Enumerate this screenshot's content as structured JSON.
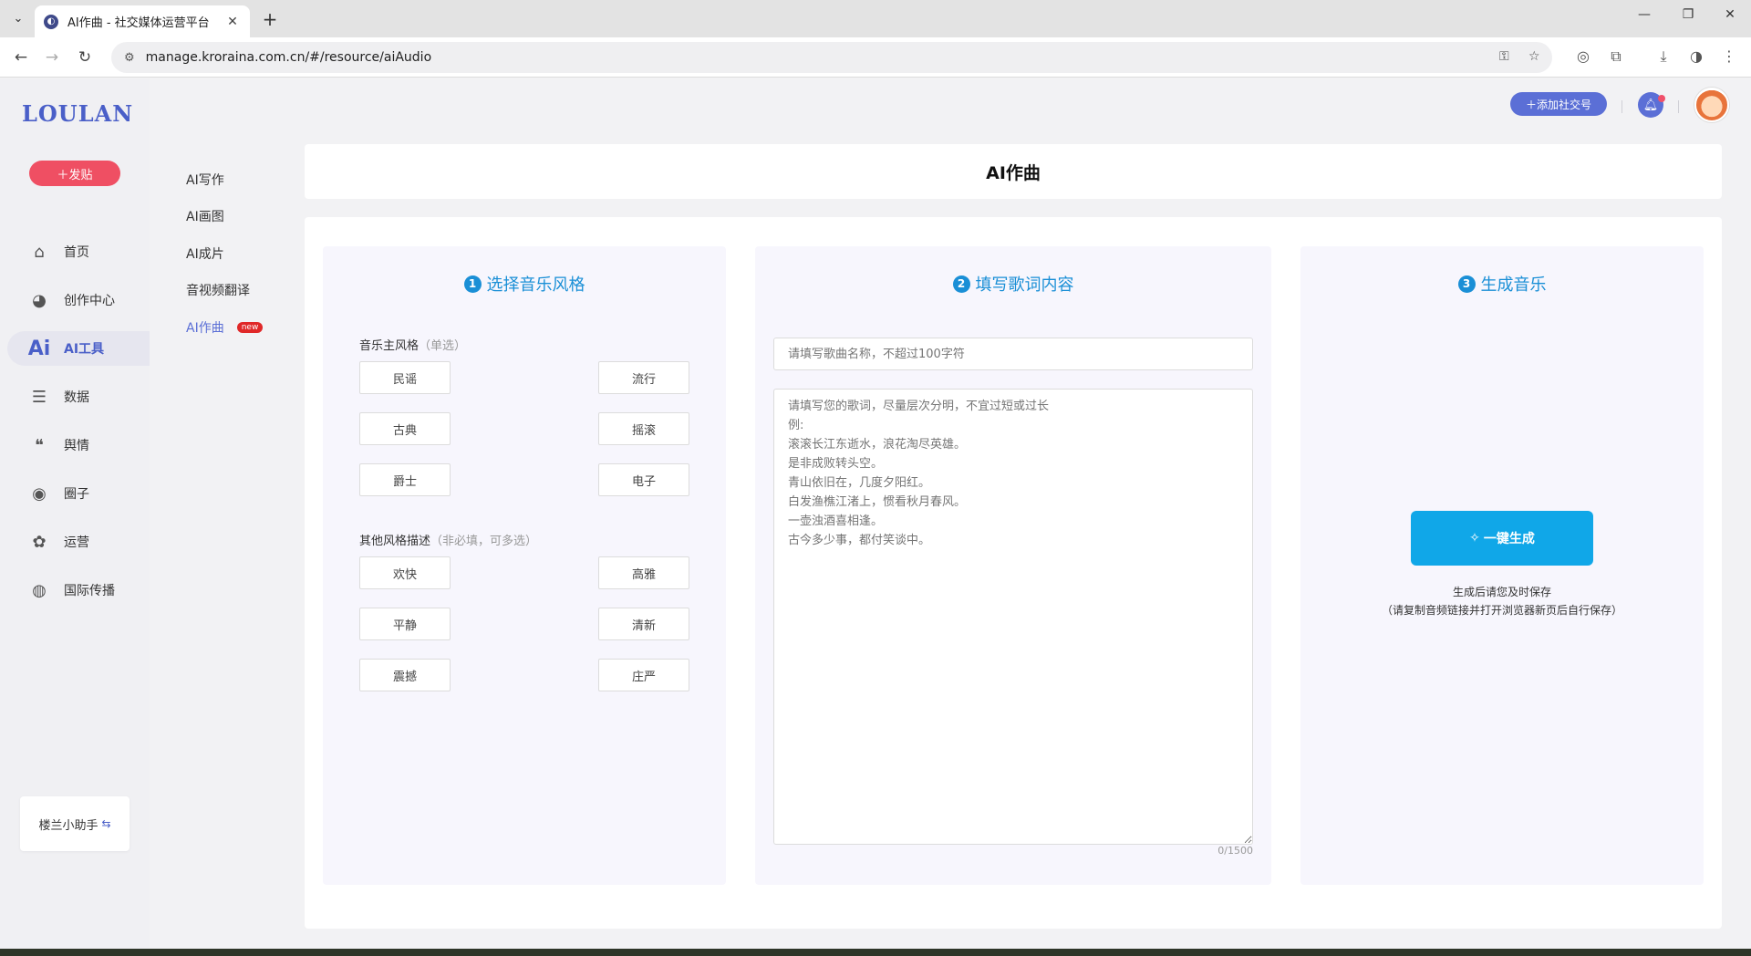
{
  "browser": {
    "tab_title": "AI作曲 - 社交媒体运营平台",
    "url": "manage.kroraina.com.cn/#/resource/aiAudio"
  },
  "app": {
    "logo": "LOULAN",
    "post_button": "＋发贴",
    "add_social_button": "＋添加社交号",
    "assistant": "楼兰小助手",
    "nav": [
      {
        "label": "首页",
        "icon": "home-icon"
      },
      {
        "label": "创作中心",
        "icon": "palette-icon"
      },
      {
        "label": "AI工具",
        "icon": "ai-icon",
        "active": true
      },
      {
        "label": "数据",
        "icon": "database-icon"
      },
      {
        "label": "舆情",
        "icon": "quote-icon"
      },
      {
        "label": "圈子",
        "icon": "compass-icon"
      },
      {
        "label": "运营",
        "icon": "operations-icon"
      },
      {
        "label": "国际传播",
        "icon": "globe-icon"
      }
    ],
    "subnav": [
      {
        "label": "AI写作"
      },
      {
        "label": "AI画图"
      },
      {
        "label": "AI成片"
      },
      {
        "label": "音视频翻译"
      },
      {
        "label": "AI作曲",
        "active": true,
        "badge": "new"
      }
    ],
    "accent_color": "#5b6fd6"
  },
  "page": {
    "title": "AI作曲",
    "step1": {
      "number": "1",
      "title": "选择音乐风格",
      "main_label": "音乐主风格",
      "main_hint": "（单选）",
      "main_options": [
        "民谣",
        "流行",
        "古典",
        "摇滚",
        "爵士",
        "电子"
      ],
      "other_label": "其他风格描述",
      "other_hint": "（非必填，可多选）",
      "other_options": [
        "欢快",
        "高雅",
        "平静",
        "清新",
        "震撼",
        "庄严"
      ]
    },
    "step2": {
      "number": "2",
      "title": "填写歌词内容",
      "name_placeholder": "请填写歌曲名称，不超过100字符",
      "lyrics_placeholder": "请填写您的歌词，尽量层次分明，不宜过短或过长\n例:\n滚滚长江东逝水，浪花淘尽英雄。\n是非成败转头空。\n青山依旧在，几度夕阳红。\n白发渔樵江渚上，惯看秋月春风。\n一壶浊酒喜相逢。\n古今多少事，都付笑谈中。",
      "counter": "0/1500"
    },
    "step3": {
      "number": "3",
      "title": "生成音乐",
      "button": "一键生成",
      "note1": "生成后请您及时保存",
      "note2": "（请复制音频链接并打开浏览器新页后自行保存）"
    }
  }
}
